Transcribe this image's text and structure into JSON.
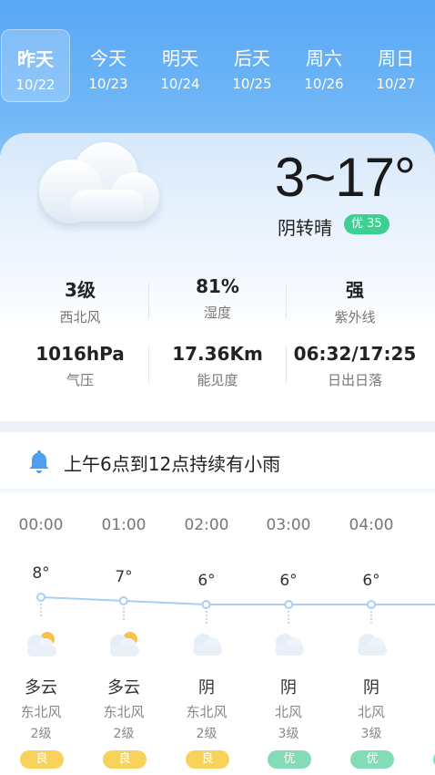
{
  "tabs": [
    {
      "name": "昨天",
      "date": "10/22",
      "active": true
    },
    {
      "name": "今天",
      "date": "10/23",
      "active": false
    },
    {
      "name": "明天",
      "date": "10/24",
      "active": false
    },
    {
      "name": "后天",
      "date": "10/25",
      "active": false
    },
    {
      "name": "周六",
      "date": "10/26",
      "active": false
    },
    {
      "name": "周日",
      "date": "10/27",
      "active": false
    }
  ],
  "current": {
    "temp_range": "3~17°",
    "condition": "阴转晴",
    "aqi": "优 35",
    "icon": "cloud-icon"
  },
  "stats": [
    {
      "value": "3级",
      "label": "西北风"
    },
    {
      "value": "81%",
      "label": "湿度"
    },
    {
      "value": "强",
      "label": "紫外线"
    },
    {
      "value": "1016hPa",
      "label": "气压"
    },
    {
      "value": "17.36Km",
      "label": "能见度"
    },
    {
      "value": "06:32/17:25",
      "label": "日出日落"
    }
  ],
  "alert": {
    "text": "上午6点到12点持续有小雨",
    "icon": "bell-icon"
  },
  "hourly": [
    {
      "time": "00:00",
      "temp": "8°",
      "temp_value": 8,
      "condition": "多云",
      "icon": "partly-cloudy-icon",
      "wind_dir": "东北风",
      "wind_level": "2级",
      "aqi": "良"
    },
    {
      "time": "01:00",
      "temp": "7°",
      "temp_value": 7,
      "condition": "多云",
      "icon": "partly-cloudy-icon",
      "wind_dir": "东北风",
      "wind_level": "2级",
      "aqi": "良"
    },
    {
      "time": "02:00",
      "temp": "6°",
      "temp_value": 6,
      "condition": "阴",
      "icon": "cloud-icon",
      "wind_dir": "东北风",
      "wind_level": "2级",
      "aqi": "良"
    },
    {
      "time": "03:00",
      "temp": "6°",
      "temp_value": 6,
      "condition": "阴",
      "icon": "cloud-icon",
      "wind_dir": "北风",
      "wind_level": "3级",
      "aqi": "优"
    },
    {
      "time": "04:00",
      "temp": "6°",
      "temp_value": 6,
      "condition": "阴",
      "icon": "cloud-icon",
      "wind_dir": "北风",
      "wind_level": "3级",
      "aqi": "优"
    }
  ],
  "colors": {
    "header_blue": "#5aa8f5",
    "aqi_good": "#3ecf93",
    "aqi_moderate": "#f7d35c",
    "curve": "#a9cff2"
  }
}
